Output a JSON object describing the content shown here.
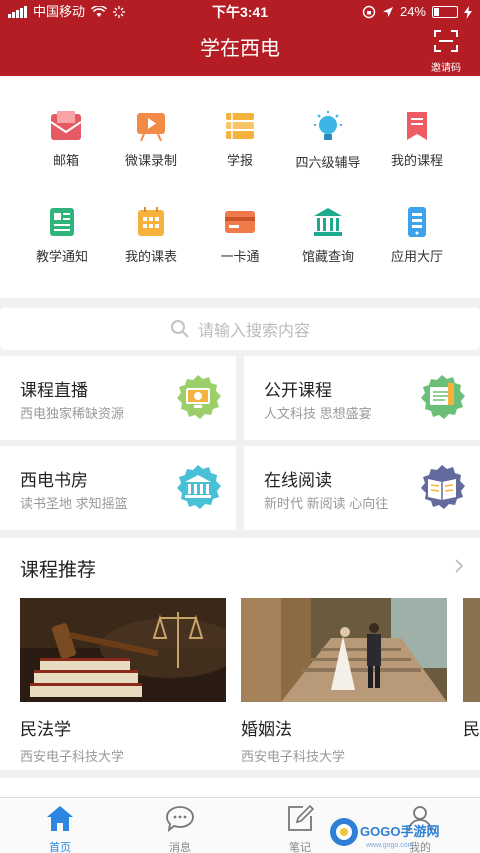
{
  "status_bar": {
    "carrier": "中国移动",
    "time": "下午3:41",
    "battery": "24%",
    "battery_level": 0.24
  },
  "header": {
    "title": "学在西电",
    "invite_label": "邀请码"
  },
  "grid": [
    {
      "label": "邮箱",
      "icon": "mail-icon",
      "color": "#e65a63"
    },
    {
      "label": "微课录制",
      "icon": "video-record-icon",
      "color": "#f28a48"
    },
    {
      "label": "学报",
      "icon": "journal-books-icon",
      "color": "#f5b23c"
    },
    {
      "label": "四六级辅导",
      "icon": "lightbulb-icon",
      "color": "#3bb4e6"
    },
    {
      "label": "我的课程",
      "icon": "bookmark-icon",
      "color": "#ef5b63"
    },
    {
      "label": "教学通知",
      "icon": "notice-icon",
      "color": "#2fb57c"
    },
    {
      "label": "我的课表",
      "icon": "calendar-icon",
      "color": "#f5b23c"
    },
    {
      "label": "一卡通",
      "icon": "card-icon",
      "color": "#f07a4a"
    },
    {
      "label": "馆藏查询",
      "icon": "library-icon",
      "color": "#1faa8f"
    },
    {
      "label": "应用大厅",
      "icon": "app-hall-icon",
      "color": "#3ea3ea"
    }
  ],
  "search": {
    "placeholder": "请输入搜索内容"
  },
  "cards": [
    {
      "title": "课程直播",
      "subtitle": "西电独家稀缺资源",
      "icon": "live-screen-icon",
      "color": "#9ccf6a"
    },
    {
      "title": "公开课程",
      "subtitle": "人文科技 思想盛宴",
      "icon": "open-book-icon",
      "color": "#6cbf78"
    },
    {
      "title": "西电书房",
      "subtitle": "读书圣地 求知摇篮",
      "icon": "library-building-icon",
      "color": "#48c1d6"
    },
    {
      "title": "在线阅读",
      "subtitle": "新时代 新阅读 心向往",
      "icon": "reading-book-icon",
      "color": "#636a9e"
    }
  ],
  "recommend": {
    "title": "课程推荐",
    "courses": [
      {
        "name": "民法学",
        "university": "西安电子科技大学"
      },
      {
        "name": "婚姻法",
        "university": "西安电子科技大学"
      },
      {
        "name": "民"
      }
    ]
  },
  "tabs": [
    {
      "label": "首页",
      "icon": "home-icon"
    },
    {
      "label": "消息",
      "icon": "message-icon"
    },
    {
      "label": "笔记",
      "icon": "note-icon"
    },
    {
      "label": "我的",
      "icon": "profile-icon"
    }
  ],
  "watermark": {
    "text": "GOGO手游网",
    "url": "www.gogo.com"
  },
  "colors": {
    "brand_red": "#b51d25",
    "tab_active": "#2a86e0"
  }
}
